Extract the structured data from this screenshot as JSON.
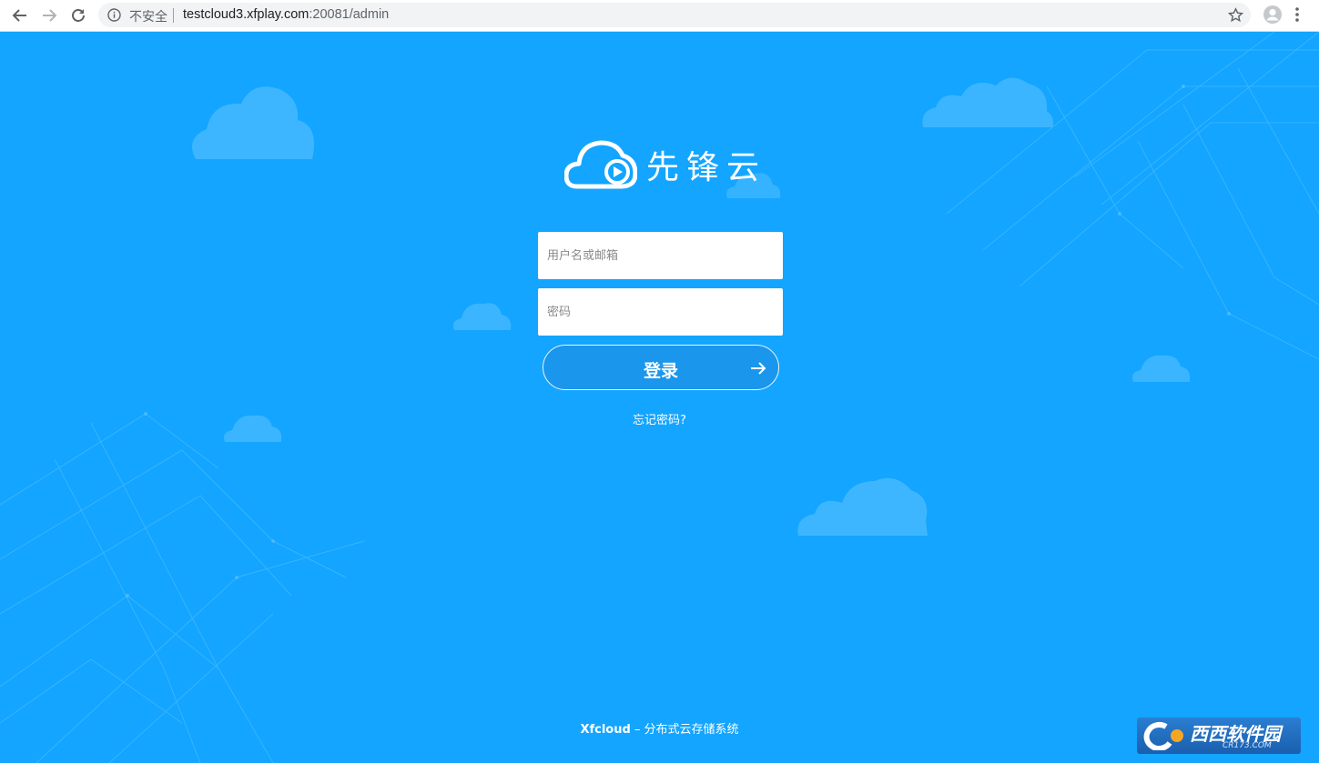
{
  "browser": {
    "security_label": "不安全",
    "url_host": "testcloud3.xfplay.com",
    "url_rest": ":20081/admin"
  },
  "brand": {
    "name": "先锋云"
  },
  "login": {
    "username_placeholder": "用户名或邮箱",
    "password_placeholder": "密码",
    "submit_label": "登录",
    "forgot_label": "忘记密码?"
  },
  "footer": {
    "product": "Xfcloud",
    "tagline": " – 分布式云存储系统"
  },
  "watermark": {
    "title": "西西软件园",
    "subtitle": "CR173.COM"
  },
  "colors": {
    "page_bg": "#13a5ff",
    "button_bg": "#1a96ec",
    "text": "#ffffff"
  },
  "icons": [
    "back-icon",
    "forward-icon",
    "reload-icon",
    "info-icon",
    "star-icon",
    "account-icon",
    "menu-icon",
    "cloud-play-logo-icon",
    "arrow-right-icon"
  ]
}
